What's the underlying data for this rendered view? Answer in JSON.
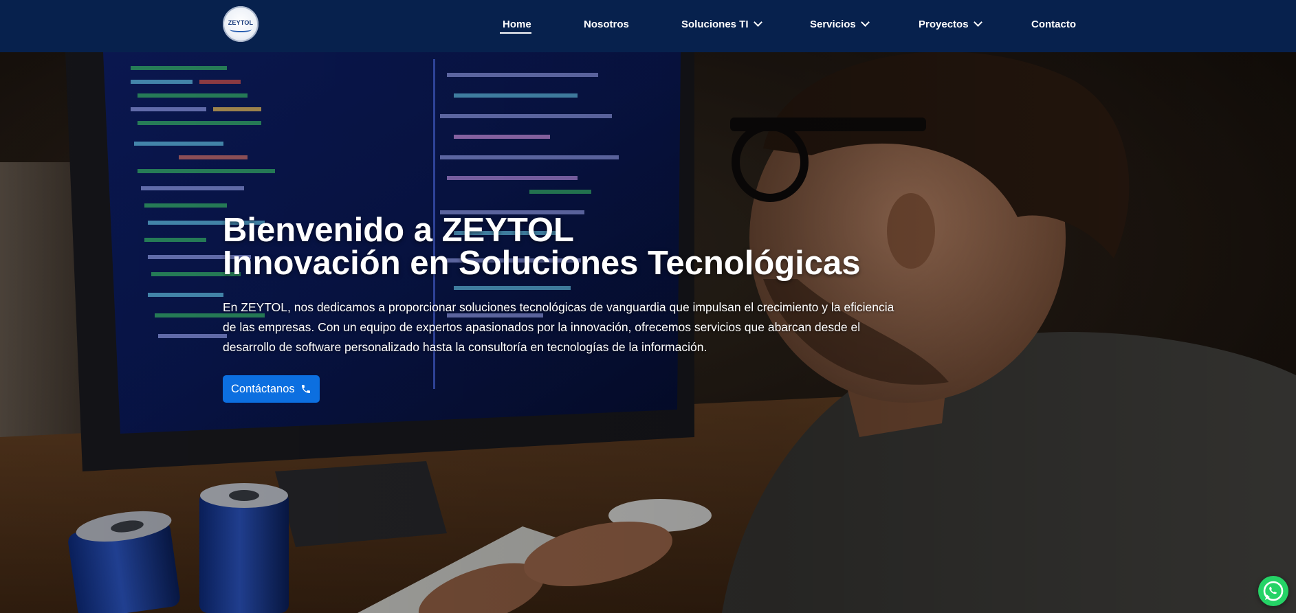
{
  "navbar": {
    "logo_text": "ZEYTOL",
    "items": [
      {
        "label": "Home",
        "has_dropdown": false,
        "active": true
      },
      {
        "label": "Nosotros",
        "has_dropdown": false,
        "active": false
      },
      {
        "label": "Soluciones TI",
        "has_dropdown": true,
        "active": false
      },
      {
        "label": "Servicios",
        "has_dropdown": true,
        "active": false
      },
      {
        "label": "Proyectos",
        "has_dropdown": true,
        "active": false
      },
      {
        "label": "Contacto",
        "has_dropdown": false,
        "active": false
      }
    ]
  },
  "hero": {
    "title_line1": "Bienvenido a ZEYTOL",
    "title_line2": "Innovación en Soluciones Tecnológicas",
    "description": "En ZEYTOL, nos dedicamos a proporcionar soluciones tecnológicas de vanguardia que impulsan el crecimiento y la eficiencia de las empresas. Con un equipo de expertos apasionados por la innovación, ofrecemos servicios que abarcan desde el desarrollo de software personalizado hasta la consultoría en tecnologías de la información.",
    "cta_label": "Contáctanos",
    "cta_icon": "phone-icon"
  },
  "floating": {
    "whatsapp_icon": "whatsapp-icon"
  },
  "colors": {
    "navbar_bg": "#07214d",
    "cta_bg": "#0c6fe0",
    "whatsapp_bg": "#25d366"
  }
}
